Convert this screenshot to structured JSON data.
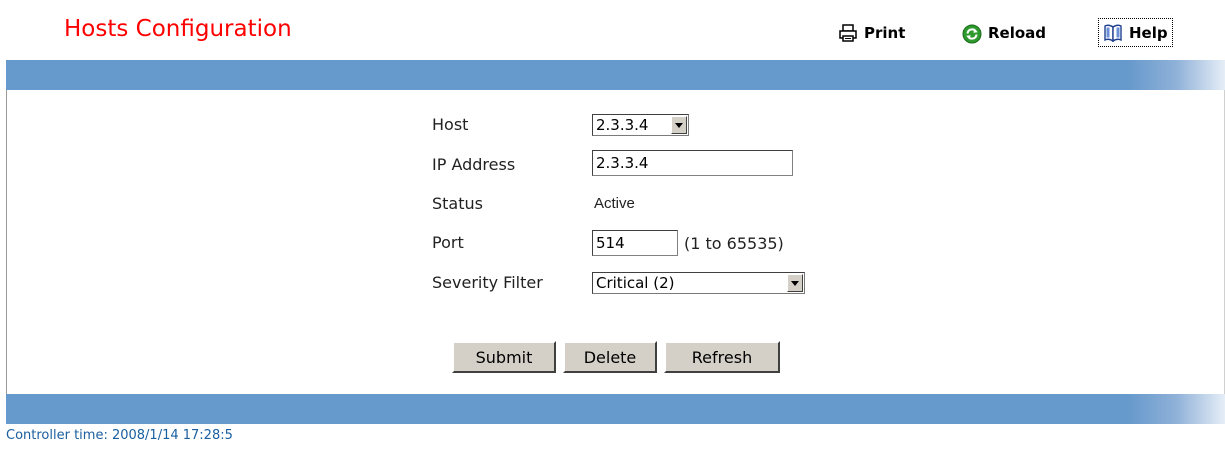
{
  "header": {
    "title": "Hosts Configuration",
    "print_label": "Print",
    "reload_label": "Reload",
    "help_label": "Help"
  },
  "form": {
    "host": {
      "label": "Host",
      "selected": "2.3.3.4"
    },
    "ip_address": {
      "label": "IP Address",
      "value": "2.3.3.4"
    },
    "status": {
      "label": "Status",
      "value": "Active"
    },
    "port": {
      "label": "Port",
      "value": "514",
      "hint": "(1 to 65535)"
    },
    "severity_filter": {
      "label": "Severity Filter",
      "selected": "Critical (2)"
    }
  },
  "buttons": {
    "submit": "Submit",
    "delete": "Delete",
    "refresh": "Refresh"
  },
  "footer": {
    "controller_time": "Controller time: 2008/1/14 17:28:5"
  },
  "colors": {
    "title": "#ff0000",
    "band": "#6699cc",
    "footer_text": "#1a5fa0"
  },
  "icons": {
    "print": "printer-icon",
    "reload": "reload-icon",
    "help": "book-icon"
  }
}
